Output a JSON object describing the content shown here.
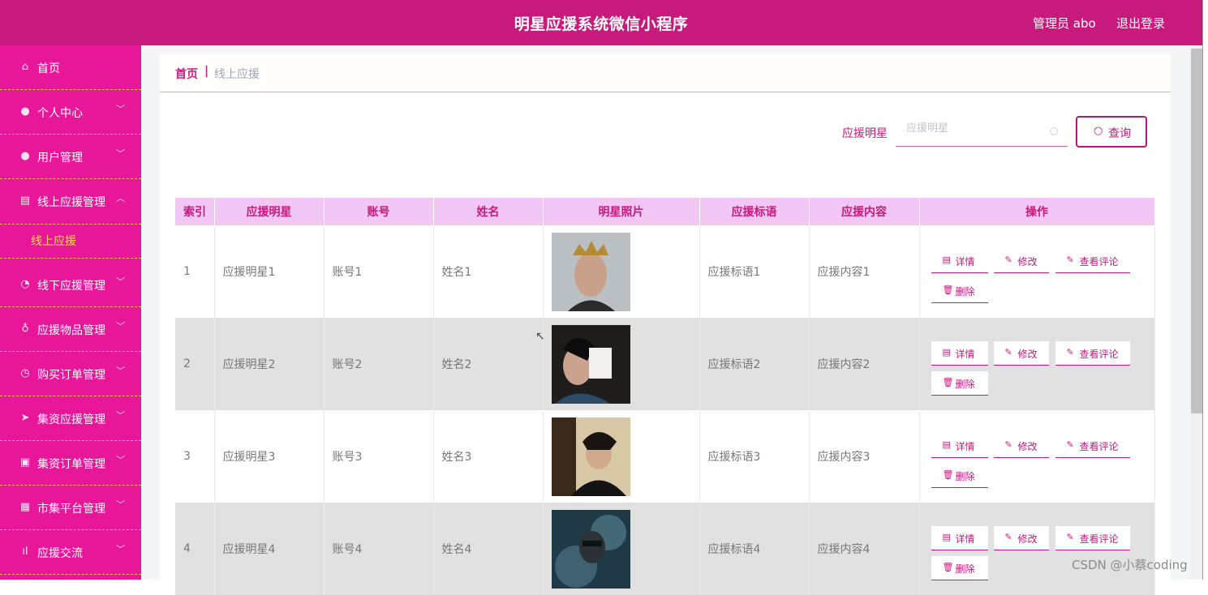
{
  "header": {
    "title": "明星应援系统微信小程序",
    "admin": "管理员 abo",
    "logout": "退出登录"
  },
  "sidebar": {
    "items": [
      {
        "label": "首页",
        "icon": "home-icon",
        "glyph": "⌂",
        "chev": ""
      },
      {
        "label": "个人中心",
        "icon": "person-icon",
        "glyph": "●",
        "chev": "﹀"
      },
      {
        "label": "用户管理",
        "icon": "user-icon",
        "glyph": "●",
        "chev": "﹀"
      },
      {
        "label": "线上应援管理",
        "icon": "clipboard-icon",
        "glyph": "▤",
        "chev": "︿"
      },
      {
        "label": "线下应援管理",
        "icon": "compass-icon",
        "glyph": "◔",
        "chev": "﹀"
      },
      {
        "label": "应援物品管理",
        "icon": "microphone-icon",
        "glyph": "♁",
        "chev": "﹀"
      },
      {
        "label": "购买订单管理",
        "icon": "clock-icon",
        "glyph": "◷",
        "chev": "﹀"
      },
      {
        "label": "集资应援管理",
        "icon": "send-icon",
        "glyph": "➤",
        "chev": "﹀"
      },
      {
        "label": "集资订单管理",
        "icon": "picture-icon",
        "glyph": "▣",
        "chev": "﹀"
      },
      {
        "label": "市集平台管理",
        "icon": "ticket-icon",
        "glyph": "▦",
        "chev": "﹀"
      },
      {
        "label": "应援交流",
        "icon": "bar-chart-icon",
        "glyph": "ıl",
        "chev": "﹀"
      }
    ],
    "sub_item": "线上应援"
  },
  "breadcrumb": {
    "home": "首页",
    "sep": "|",
    "current": "线上应援"
  },
  "search": {
    "label": "应援明星",
    "placeholder": "应援明星",
    "button": "查询"
  },
  "table": {
    "headers": [
      "索引",
      "应援明星",
      "账号",
      "姓名",
      "明星照片",
      "应援标语",
      "应援内容",
      "操作"
    ],
    "rows": [
      {
        "index": "1",
        "star": "应援明星1",
        "account": "账号1",
        "name": "姓名1",
        "slogan": "应援标语1",
        "content": "应援内容1"
      },
      {
        "index": "2",
        "star": "应援明星2",
        "account": "账号2",
        "name": "姓名2",
        "slogan": "应援标语2",
        "content": "应援内容2"
      },
      {
        "index": "3",
        "star": "应援明星3",
        "account": "账号3",
        "name": "姓名3",
        "slogan": "应援标语3",
        "content": "应援内容3"
      },
      {
        "index": "4",
        "star": "应援明星4",
        "account": "账号4",
        "name": "姓名4",
        "slogan": "应援标语4",
        "content": "应援内容4"
      }
    ],
    "actions": {
      "detail": "详情",
      "edit": "修改",
      "comments": "查看评论",
      "delete": "删除"
    }
  },
  "watermark": "CSDN @小蔡coding",
  "colors": {
    "primary": "#c8197d",
    "sidebar": "#e8179a",
    "header_row": "#f2c7f4",
    "sub_active": "#ffd84a"
  }
}
